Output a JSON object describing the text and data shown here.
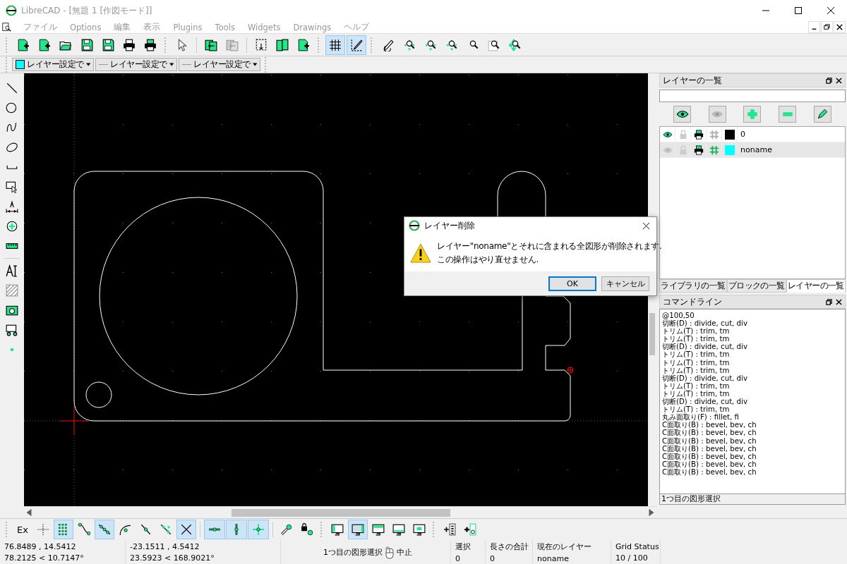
{
  "window": {
    "title": "LibreCAD - [無題 1 [作図モード]]"
  },
  "menu": [
    "ファイル",
    "Options",
    "編集",
    "表示",
    "Plugins",
    "Tools",
    "Widgets",
    "Drawings",
    "ヘルプ"
  ],
  "view_toggles": [
    {
      "selected": true
    },
    {
      "selected": true
    }
  ],
  "pen_toolbar": [
    {
      "kind": "color",
      "label": "レイヤー設定で",
      "color": "#00ffff"
    },
    {
      "kind": "width",
      "label": "レイヤー設定で"
    },
    {
      "kind": "type",
      "label": "レイヤー設定で"
    }
  ],
  "layer_panel": {
    "title": "レイヤーの一覧",
    "layers": [
      {
        "name": "0",
        "visible": true,
        "locked": false,
        "printable": true,
        "construction": false,
        "color": "#000000",
        "selected": false
      },
      {
        "name": "noname",
        "visible": false,
        "locked": false,
        "printable": true,
        "construction": true,
        "color": "#00ffff",
        "selected": true
      }
    ],
    "tabs": [
      {
        "label": "ライブラリの一覧",
        "selected": false
      },
      {
        "label": "ブロックの一覧",
        "selected": false
      },
      {
        "label": "レイヤーの一覧",
        "selected": true
      }
    ]
  },
  "command_panel": {
    "title": "コマンドライン",
    "history": [
      "@100,50",
      "切断(D) : divide, cut, div",
      "トリム(T) : trim, tm",
      "トリム(T) : trim, tm",
      "切断(D) : divide, cut, div",
      "トリム(T) : trim, tm",
      "トリム(T) : trim, tm",
      "トリム(T) : trim, tm",
      "切断(D) : divide, cut, div",
      "トリム(T) : trim, tm",
      "トリム(T) : trim, tm",
      "切断(D) : divide, cut, div",
      "トリム(T) : trim, tm",
      "丸み面取り(F) : fillet, fi",
      "C面取り(B) : bevel, bev, ch",
      "C面取り(B) : bevel, bev, ch",
      "C面取り(B) : bevel, bev, ch",
      "C面取り(B) : bevel, bev, ch",
      "C面取り(B) : bevel, bev, ch",
      "C面取り(B) : bevel, bev, ch",
      "C面取り(B) : bevel, bev, ch"
    ],
    "prompt": "1つ目の図形選択"
  },
  "snap_toolbar": {
    "exclusive_label": "Ex",
    "snaps": [
      {
        "selected": false
      },
      {
        "selected": true
      },
      {
        "selected": false
      },
      {
        "selected": true
      },
      {
        "selected": false
      },
      {
        "selected": false
      },
      {
        "selected": false
      },
      {
        "selected": true
      }
    ],
    "restrictions": [
      {
        "selected": true
      },
      {
        "selected": true
      },
      {
        "selected": true
      }
    ],
    "views": [
      {
        "selected": false
      },
      {
        "selected": true
      },
      {
        "selected": false
      },
      {
        "selected": false
      },
      {
        "selected": false
      }
    ]
  },
  "status_bar": {
    "absolute": [
      "76.8489 , 14.5412",
      "78.2125 < 10.7147°"
    ],
    "relative": [
      "-23.1511 , 4.5412",
      "23.5923 < 168.9021°"
    ],
    "mouse": {
      "left": "1つ目の図形選択",
      "right": "中止"
    },
    "fields": [
      {
        "label": "選択",
        "value": "0"
      },
      {
        "label": "長さの合計",
        "value": "0"
      },
      {
        "label": "現在のレイヤー",
        "value": "noname"
      },
      {
        "label": "Grid Status",
        "value": "10 / 100"
      }
    ]
  },
  "dialog": {
    "title": "レイヤー削除",
    "message": [
      "レイヤー\"noname\"とそれに含まれる全図形が削除されます.",
      "この操作はやり直せません."
    ],
    "buttons": [
      {
        "label": "OK",
        "selected": true
      },
      {
        "label": "キャンセル",
        "selected": false
      }
    ]
  }
}
